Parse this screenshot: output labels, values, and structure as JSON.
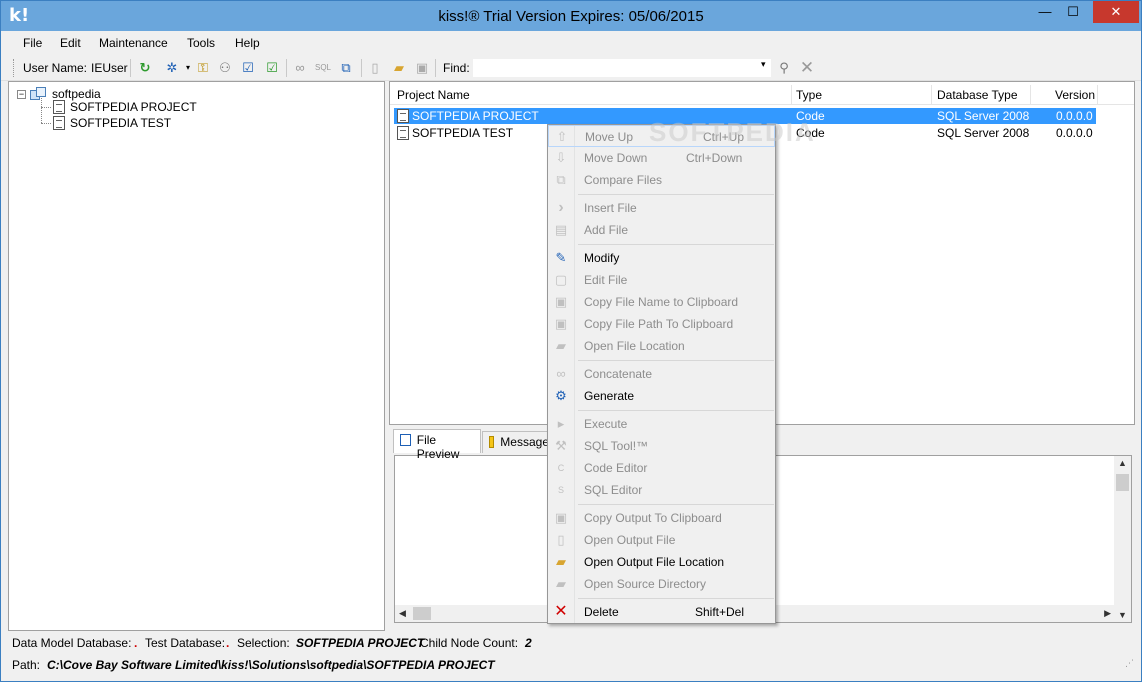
{
  "window": {
    "logo": "k!",
    "title": "kiss!® Trial Version Expires: 05/06/2015",
    "min_glyph": "—",
    "max_glyph": "☐",
    "close_glyph": "✕"
  },
  "menubar": {
    "items": [
      {
        "label": "File"
      },
      {
        "label": "Edit"
      },
      {
        "label": "Maintenance"
      },
      {
        "label": "Tools"
      },
      {
        "label": "Help"
      }
    ]
  },
  "toolbar": {
    "user_label": "User Name:",
    "user_value": "IEUser",
    "find_label": "Find:",
    "find_value": "",
    "icons": [
      "refresh-icon",
      "wand-icon",
      "keys-icon",
      "users-icon",
      "check-doc-icon",
      "check-doc-green-icon",
      "link-icon",
      "sql-icon",
      "generate-icon",
      "new-file-icon",
      "open-folder-icon",
      "clipboard-icon",
      "binoculars-icon",
      "clear-icon"
    ]
  },
  "tree": {
    "root": "softpedia",
    "toggle": "−",
    "children": [
      {
        "label": "SOFTPEDIA PROJECT"
      },
      {
        "label": "SOFTPEDIA TEST"
      }
    ]
  },
  "list": {
    "headers": {
      "name": "Project Name",
      "type": "Type",
      "dbtype": "Database Type",
      "version": "Version"
    },
    "rows": [
      {
        "name": "SOFTPEDIA PROJECT",
        "type": "Code",
        "dbtype": "SQL Server 2008",
        "version": "0.0.0.0",
        "selected": true
      },
      {
        "name": "SOFTPEDIA TEST",
        "type": "Code",
        "dbtype": "SQL Server 2008",
        "version": "0.0.0.0",
        "selected": false
      }
    ]
  },
  "bottom": {
    "tabs": [
      {
        "label": "File Preview",
        "active": true
      },
      {
        "label": "Messages",
        "active": false
      }
    ]
  },
  "context_menu": {
    "items": [
      {
        "label": "Move Up",
        "shortcut": "Ctrl+Up",
        "icon": "arrow-up-icon",
        "glyph": "⇧",
        "enabled": false
      },
      {
        "label": "Move Down",
        "shortcut": "Ctrl+Down",
        "icon": "arrow-down-icon",
        "glyph": "⇩",
        "enabled": false
      },
      {
        "label": "Compare Files",
        "shortcut": "",
        "icon": "compare-icon",
        "glyph": "⧉",
        "enabled": false
      },
      {
        "label": "Insert File",
        "shortcut": "",
        "icon": "chevron-right-icon",
        "glyph": "›",
        "enabled": false
      },
      {
        "label": "Add File",
        "shortcut": "",
        "icon": "add-file-icon",
        "glyph": "▤",
        "enabled": false
      },
      {
        "label": "Modify",
        "shortcut": "",
        "icon": "modify-icon",
        "glyph": "✎",
        "enabled": true
      },
      {
        "label": "Edit File",
        "shortcut": "",
        "icon": "edit-file-icon",
        "glyph": "▢",
        "enabled": false
      },
      {
        "label": "Copy File Name to Clipboard",
        "shortcut": "",
        "icon": "clipboard-icon",
        "glyph": "▣",
        "enabled": false
      },
      {
        "label": "Copy File Path To Clipboard",
        "shortcut": "",
        "icon": "clipboard-icon",
        "glyph": "▣",
        "enabled": false
      },
      {
        "label": "Open File Location",
        "shortcut": "",
        "icon": "folder-icon",
        "glyph": "▰",
        "enabled": false
      },
      {
        "label": "Concatenate",
        "shortcut": "",
        "icon": "link-icon",
        "glyph": "∞",
        "enabled": false
      },
      {
        "label": "Generate",
        "shortcut": "",
        "icon": "generate-icon",
        "glyph": "⚙",
        "enabled": true
      },
      {
        "label": "Execute",
        "shortcut": "",
        "icon": "execute-sql-icon",
        "glyph": "▸",
        "enabled": false
      },
      {
        "label": "SQL Tool!™",
        "shortcut": "",
        "icon": "sql-tool-icon",
        "glyph": "⚒",
        "enabled": false
      },
      {
        "label": "Code Editor",
        "shortcut": "",
        "icon": "code-icon",
        "glyph": "C",
        "enabled": false
      },
      {
        "label": "SQL Editor",
        "shortcut": "",
        "icon": "sql-icon",
        "glyph": "S",
        "enabled": false
      },
      {
        "label": "Copy Output To Clipboard",
        "shortcut": "",
        "icon": "clipboard-icon",
        "glyph": "▣",
        "enabled": false
      },
      {
        "label": "Open Output File",
        "shortcut": "",
        "icon": "file-icon",
        "glyph": "▯",
        "enabled": false
      },
      {
        "label": "Open Output File Location",
        "shortcut": "",
        "icon": "open-folder-icon",
        "glyph": "▰",
        "enabled": true
      },
      {
        "label": "Open Source Directory",
        "shortcut": "",
        "icon": "folder-icon",
        "glyph": "▰",
        "enabled": false
      },
      {
        "label": "Delete",
        "shortcut": "Shift+Del",
        "icon": "delete-icon",
        "glyph": "✕",
        "enabled": true
      }
    ]
  },
  "status": {
    "data_model_label": "Data Model Database:",
    "data_model_value": ".",
    "test_db_label": "Test Database:",
    "test_db_value": ".",
    "selection_label": "Selection:",
    "selection_value": "SOFTPEDIA PROJECT",
    "child_count_label": "Child Node Count:",
    "child_count_value": "2",
    "path_label": "Path:",
    "path_value": "C:\\Cove Bay Software Limited\\kiss!\\Solutions\\softpedia\\SOFTPEDIA PROJECT"
  },
  "watermark": "SOFTPEDIA",
  "colors": {
    "titlebar": "#6aa6dc",
    "selection": "#3399ff",
    "close": "#c7382d",
    "delete": "#d00000"
  }
}
